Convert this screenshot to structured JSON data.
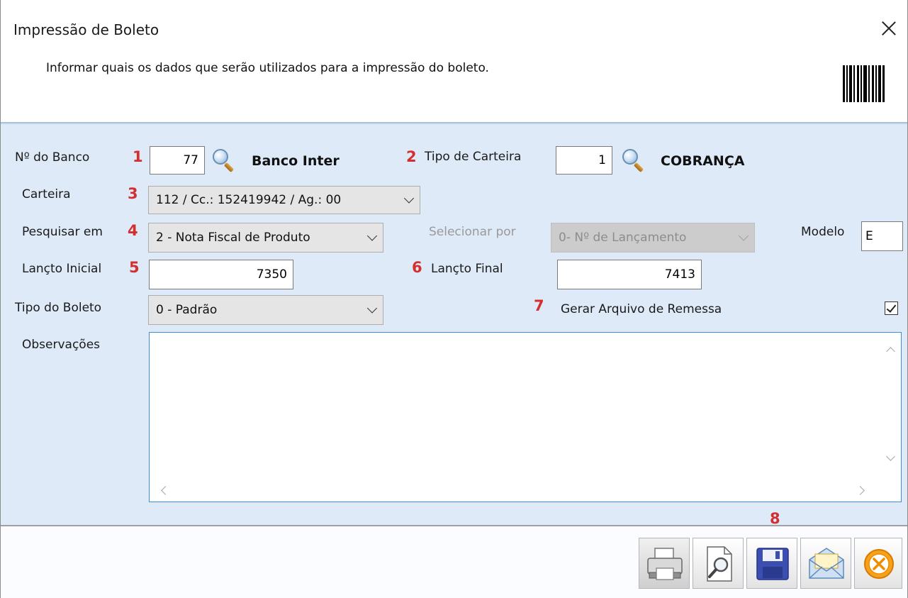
{
  "window": {
    "title": "Impressão de Boleto",
    "subtitle": "Informar quais os dados que serão utilizados para a impressão do boleto."
  },
  "form": {
    "banco": {
      "label": "Nº do Banco",
      "marker": "1",
      "value": "77",
      "name": "Banco Inter"
    },
    "tipo_carteira": {
      "label": "Tipo de Carteira",
      "marker": "2",
      "value": "1",
      "name": "COBRANÇA"
    },
    "carteira": {
      "label": "Carteira",
      "marker": "3",
      "value": "112 / Cc.: 152419942 / Ag.: 00"
    },
    "pesquisar_em": {
      "label": "Pesquisar em",
      "marker": "4",
      "value": "2 - Nota Fiscal de Produto"
    },
    "selecionar_por": {
      "label": "Selecionar por",
      "value": "0- Nº de Lançamento"
    },
    "modelo": {
      "label": "Modelo",
      "value": "E"
    },
    "lancto_inicial": {
      "label": "Lançto Inicial",
      "marker": "5",
      "value": "7350"
    },
    "lancto_final": {
      "label": "Lançto Final",
      "marker": "6",
      "value": "7413"
    },
    "tipo_boleto": {
      "label": "Tipo do Boleto",
      "value": "0 - Padrão"
    },
    "remessa": {
      "label": "Gerar Arquivo de Remessa",
      "marker": "7",
      "checked": true
    },
    "observacoes": {
      "label": "Observações",
      "value": ""
    }
  },
  "toolbar": {
    "marker": "8",
    "buttons": [
      "printer-icon",
      "preview-icon",
      "save-icon",
      "email-icon",
      "cancel-icon"
    ]
  },
  "colors": {
    "panel_bg": "#deeaf8",
    "marker_red": "#d32f2f",
    "memo_border": "#3b8ed6"
  }
}
